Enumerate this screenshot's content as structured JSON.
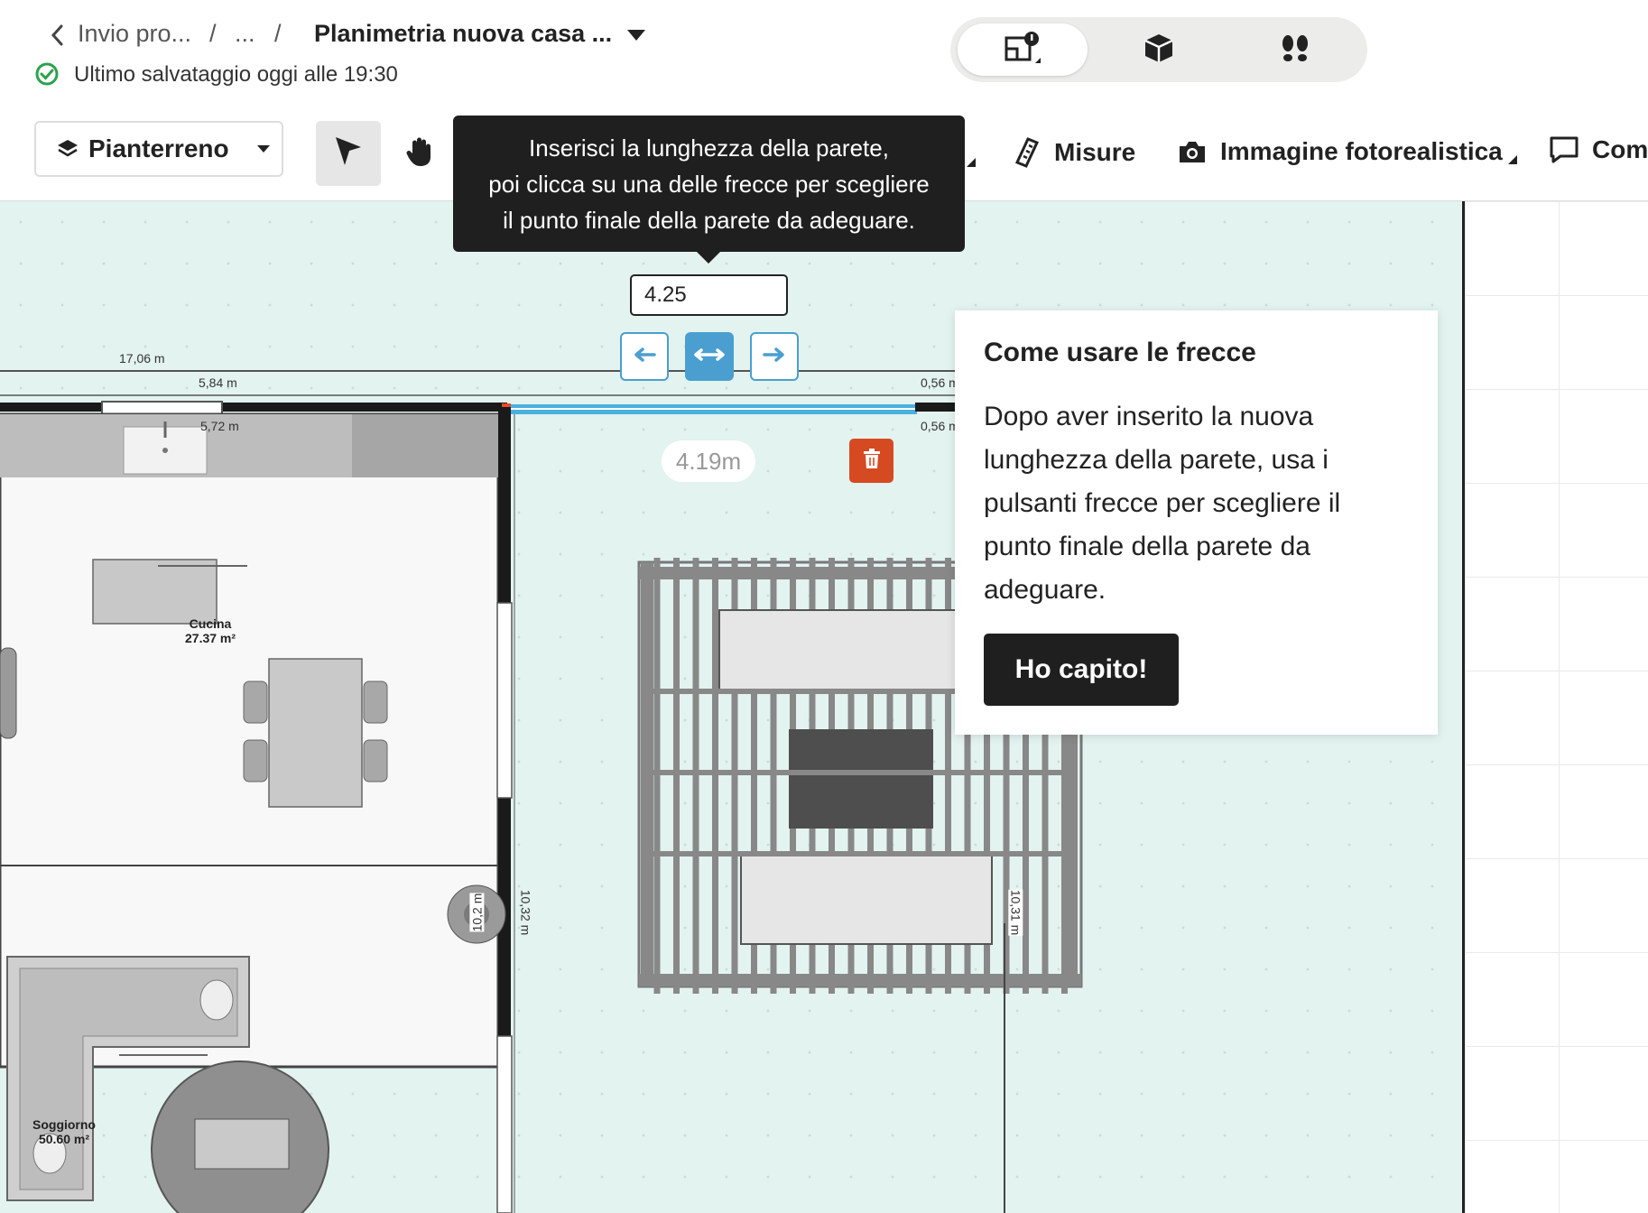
{
  "header": {
    "back_crumb": "Invio pro...",
    "ellipsis_crumb": "...",
    "separator": "/",
    "project_title": "Planimetria nuova casa ...",
    "save_status": "Ultimo salvataggio oggi alle 19:30"
  },
  "view_switch": {
    "items": [
      {
        "icon": "floorplan-2d-icon",
        "active": true
      },
      {
        "icon": "cube-3d-icon",
        "active": false
      },
      {
        "icon": "footsteps-icon",
        "active": false
      }
    ]
  },
  "toolbar": {
    "floor_label": "Pianterreno",
    "tools": [
      "pointer-icon",
      "hand-icon"
    ],
    "measures_label": "Misure",
    "photo_label": "Immagine fotorealistica",
    "comments_label": "Com"
  },
  "tooltip": {
    "line1": "Inserisci la lunghezza della parete,",
    "line2": "poi clicca su una delle frecce per scegliere",
    "line3": "il punto finale della parete da adeguare."
  },
  "wall_editor": {
    "length_value": "4.25",
    "current_length": "4.19m"
  },
  "help_popup": {
    "title": "Come usare le frecce",
    "body": "Dopo aver inserito la nuova lunghezza della parete, usa i pulsanti frecce per scegliere il punto finale della parete da adeguare.",
    "button": "Ho capito!"
  },
  "floorplan": {
    "dimensions": {
      "total_top": "17,06 m",
      "kitchen_outer": "5,84 m",
      "kitchen_inner": "5,72 m",
      "right_outer": "0,56 m",
      "right_inner": "0,56 m",
      "wall_inner_v": "10,2 m",
      "wall_outer_v": "10,32 m",
      "right_v": "10,31 m"
    },
    "rooms": [
      {
        "name": "Cucina",
        "area": "27.37 m²"
      },
      {
        "name": "Soggiorno",
        "area": "50.60 m²"
      }
    ]
  },
  "colors": {
    "accent": "#4a9fd0",
    "dark": "#1f1f1f",
    "delete": "#d64a22",
    "canvas": "#e3f3ef",
    "save_ok": "#2ca24f"
  }
}
